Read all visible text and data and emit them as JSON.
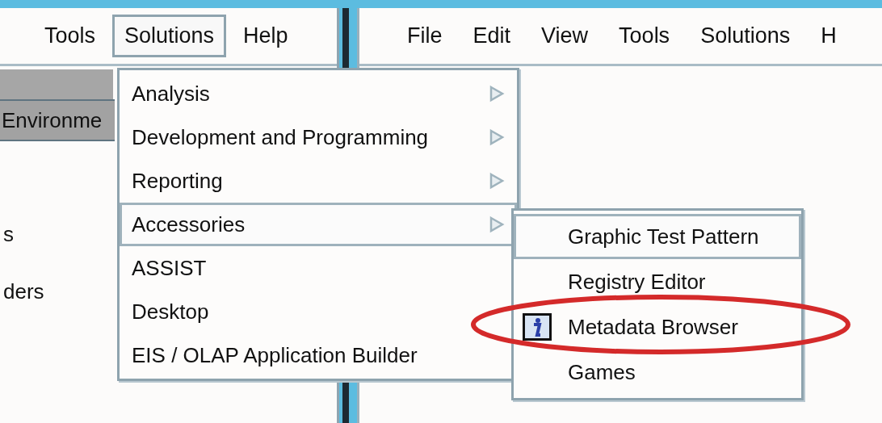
{
  "left_window": {
    "menu_bar": [
      {
        "label": "Tools",
        "selected": false
      },
      {
        "label": "Solutions",
        "selected": true
      },
      {
        "label": "Help",
        "selected": false
      }
    ],
    "panel_tab": "Environme",
    "list_items": [
      "s",
      "ders"
    ]
  },
  "right_window": {
    "menu_bar": [
      {
        "label": "File",
        "selected": false
      },
      {
        "label": "Edit",
        "selected": false
      },
      {
        "label": "View",
        "selected": false
      },
      {
        "label": "Tools",
        "selected": false
      },
      {
        "label": "Solutions",
        "selected": false
      },
      {
        "label": "H",
        "selected": false
      }
    ]
  },
  "solutions_menu": {
    "items": [
      {
        "label": "Analysis",
        "has_submenu": true,
        "selected": false
      },
      {
        "label": "Development and Programming",
        "has_submenu": true,
        "selected": false
      },
      {
        "label": "Reporting",
        "has_submenu": true,
        "selected": false
      },
      {
        "label": "Accessories",
        "has_submenu": true,
        "selected": true
      },
      {
        "label": "ASSIST",
        "has_submenu": false,
        "selected": false
      },
      {
        "label": "Desktop",
        "has_submenu": false,
        "selected": false
      },
      {
        "label": "EIS / OLAP Application Builder",
        "has_submenu": false,
        "selected": false
      }
    ]
  },
  "accessories_menu": {
    "items": [
      {
        "label": "Graphic Test Pattern",
        "has_icon": false,
        "selected": true
      },
      {
        "label": "Registry Editor",
        "has_icon": false,
        "selected": false
      },
      {
        "label": "Metadata Browser",
        "has_icon": true,
        "selected": false
      },
      {
        "label": "Games",
        "has_icon": false,
        "selected": false
      }
    ]
  },
  "annotation": {
    "kind": "ellipse"
  }
}
